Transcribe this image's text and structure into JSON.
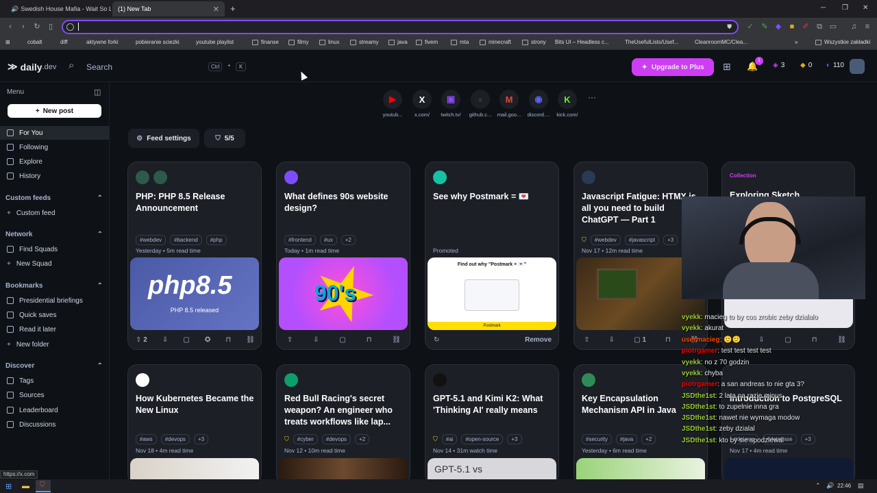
{
  "browser": {
    "tabs": [
      {
        "label": "Swedish House Mafia - Wait So L",
        "active": false
      },
      {
        "label": "(1) New Tab",
        "active": true
      }
    ],
    "new_tab": "+",
    "window_controls": [
      "─",
      "❐",
      "✕"
    ],
    "url": "",
    "bookmarks": [
      "cobalt",
      "diff",
      "aktywne forki",
      "pobieranie sciezki",
      "youtube playlist",
      "finanse",
      "filmy",
      "linux",
      "streamy",
      "java",
      "fivem",
      "mta",
      "minecraft",
      "strony",
      "Bits UI – Headless c...",
      "TheUsefulLists/Usef...",
      "CleanroomMC/Clea..."
    ],
    "bookmarks_more": "»",
    "all_bookmarks": "Wszystkie zakładki",
    "status_url": "https://x.com"
  },
  "header": {
    "logo": "daily",
    "logo_suffix": ".dev",
    "search_placeholder": "Search",
    "search_shortcut_ctrl": "Ctrl",
    "search_shortcut_plus": "+",
    "search_shortcut_key": "K",
    "upgrade_label": "Upgrade to Plus",
    "notifications_count": "1",
    "reputation": "3",
    "cores": "0",
    "points": "110"
  },
  "sidebar": {
    "menu_label": "Menu",
    "new_post": "New post",
    "main": [
      "For You",
      "Following",
      "Explore",
      "History"
    ],
    "custom_feeds_label": "Custom feeds",
    "custom_feeds": [
      "Custom feed"
    ],
    "network_label": "Network",
    "network": [
      "Find Squads",
      "New Squad"
    ],
    "bookmarks_label": "Bookmarks",
    "bookmarks": [
      "Presidential briefings",
      "Quick saves",
      "Read it later",
      "New folder"
    ],
    "discover_label": "Discover",
    "discover": [
      "Tags",
      "Sources",
      "Leaderboard",
      "Discussions"
    ]
  },
  "shortcuts": [
    {
      "label": "youtub...",
      "color": "#ff0000",
      "glyph": "▶"
    },
    {
      "label": "x.com/",
      "color": "#ffffff",
      "glyph": "X"
    },
    {
      "label": "twitch.tv/",
      "color": "#9146ff",
      "glyph": "▣"
    },
    {
      "label": "github.c...",
      "color": "#333333",
      "glyph": "●"
    },
    {
      "label": "mail.goo...",
      "color": "#ea4335",
      "glyph": "M"
    },
    {
      "label": "discord....",
      "color": "#5865f2",
      "glyph": "◉"
    },
    {
      "label": "kick.com/",
      "color": "#53fc18",
      "glyph": "K"
    }
  ],
  "shortcuts_more": "···",
  "feed": {
    "settings_label": "Feed settings",
    "shield_count": "5/5"
  },
  "cards_row1": [
    {
      "title": "PHP: PHP 8.5 Release Announcement",
      "tags": [
        "#webdev",
        "#backend",
        "#php"
      ],
      "meta": "Yesterday • 5m read time",
      "thumb_title": "php8.5",
      "thumb_sub": "PHP 8.5 released",
      "upvotes": "2"
    },
    {
      "title": "What defines 90s website design?",
      "tags": [
        "#frontend",
        "#ux",
        "+2"
      ],
      "meta": "Today • 1m read time",
      "thumb_title": "90's"
    },
    {
      "title": "See why Postmark = 💌",
      "meta": "Promoted",
      "thumb_title": "Find out why \"Postmark = 💌\"",
      "thumb_sub": "Postmark",
      "remove_label": "Remove"
    },
    {
      "title": "Javascript Fatigue: HTMX is all you need to build ChatGPT — Part 1",
      "tags": [
        "#webdev",
        "#javascript",
        "+3"
      ],
      "meta": "Nov 17 • 12m read time",
      "comments": "1"
    },
    {
      "badge": "Collection",
      "title": "Exploring Sketch"
    }
  ],
  "cards_row2": [
    {
      "title": "How Kubernetes Became the New Linux",
      "tags": [
        "#aws",
        "#devops",
        "+3"
      ],
      "meta": "Nov 18 • 4m read time"
    },
    {
      "title": "Red Bull Racing's secret weapon? An engineer who treats workflows like lap...",
      "tags": [
        "#cyber",
        "#devops",
        "+2"
      ],
      "meta": "Nov 12 • 10m read time"
    },
    {
      "title": "GPT-5.1 and Kimi K2: What 'Thinking AI' really means",
      "tags": [
        "#ai",
        "#open-source",
        "+3"
      ],
      "meta": "Nov 14 • 31m watch time",
      "thumb_title": "GPT-5.1 vs"
    },
    {
      "title": "Key Encapsulation Mechanism API in Java",
      "tags": [
        "#security",
        "#java",
        "+2"
      ],
      "meta": "Yesterday • 6m read time"
    },
    {
      "title": "Introduction to PostgreSQL",
      "tags": [
        "#devops",
        "#database",
        "+3"
      ],
      "meta": "Nov 17 • 4m read time"
    }
  ],
  "chat": [
    {
      "user": "vyekk",
      "color": "#9acd32",
      "text": "macieg to by cos zrobic zeby dzialalo"
    },
    {
      "user": "vyekk",
      "color": "#9acd32",
      "text": "akurat"
    },
    {
      "user": "usermacieg",
      "color": "#ff4500",
      "text": "🙂🙂"
    },
    {
      "user": "piotrgamer",
      "color": "#ff0000",
      "text": "test test test test"
    },
    {
      "user": "vyekk",
      "color": "#9acd32",
      "text": "no z 70 godzin"
    },
    {
      "user": "vyekk",
      "color": "#9acd32",
      "text": "chyba"
    },
    {
      "user": "piotrgamer",
      "color": "#ff0000",
      "text": "a san andreas to nie gta 3?"
    },
    {
      "user": "JSDthe1st",
      "color": "#9acd32",
      "text": "2 lata na razie minus"
    },
    {
      "user": "JSDthe1st",
      "color": "#9acd32",
      "text": "to zupelnie inna gra"
    },
    {
      "user": "JSDthe1st",
      "color": "#9acd32",
      "text": "nawet nie wymaga modow"
    },
    {
      "user": "JSDthe1st",
      "color": "#9acd32",
      "text": "zeby dzialal"
    },
    {
      "user": "JSDthe1st",
      "color": "#9acd32",
      "text": "kto by sie spodziewal"
    }
  ],
  "taskbar": {
    "time": "22:46"
  },
  "colors": {
    "accent": "#ce3df3",
    "brand_blue": "#7c4dff"
  }
}
